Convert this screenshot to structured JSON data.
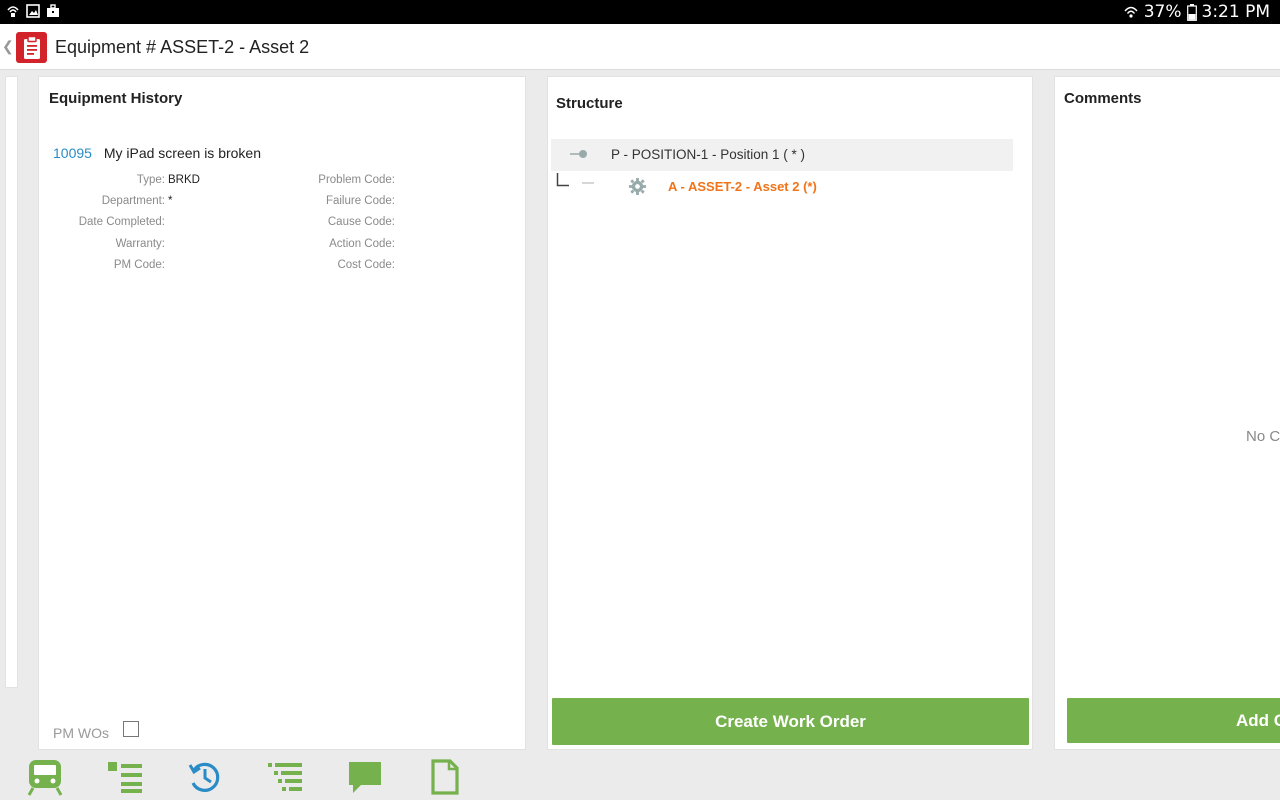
{
  "status_bar": {
    "battery": "37%",
    "time": "3:21 PM",
    "notification_icons": [
      "wifi-tethering-icon",
      "image-icon",
      "briefcase-icon"
    ]
  },
  "header": {
    "title": "Equipment # ASSET-2 - Asset 2",
    "logo_icon": "clipboard-icon",
    "back_icon": "chevron-left-icon"
  },
  "history": {
    "title": "Equipment History",
    "work_order": {
      "number": "10095",
      "description": "My iPad screen is broken"
    },
    "fields_left": [
      {
        "label": "Type:",
        "value": "BRKD"
      },
      {
        "label": "Department:",
        "value": "*"
      },
      {
        "label": "Date Completed:",
        "value": ""
      },
      {
        "label": "Warranty:",
        "value": ""
      },
      {
        "label": "PM Code:",
        "value": ""
      }
    ],
    "fields_right": [
      {
        "label": "Problem Code:",
        "value": ""
      },
      {
        "label": "Failure Code:",
        "value": ""
      },
      {
        "label": "Cause Code:",
        "value": ""
      },
      {
        "label": "Action Code:",
        "value": ""
      },
      {
        "label": "Cost Code:",
        "value": ""
      }
    ],
    "pm_wos_label": "PM WOs",
    "pm_wos_checked": false
  },
  "structure": {
    "title": "Structure",
    "nodes": [
      {
        "label": "P - POSITION-1 - Position 1 ( * )",
        "icon": "position-pin-icon"
      },
      {
        "label": "A - ASSET-2 - Asset 2 (*)",
        "icon": "gear-icon"
      }
    ],
    "create_button": "Create Work Order"
  },
  "comments": {
    "title": "Comments",
    "empty_text": "No C",
    "add_button": "Add C"
  },
  "toolbar": {
    "icons": [
      "train-icon",
      "list-icon",
      "history-icon",
      "indented-list-icon",
      "comment-icon",
      "document-icon"
    ],
    "active_index": 2,
    "accent_color": "#75b14c",
    "active_color": "#2a8cc7"
  },
  "colors": {
    "accent_green": "#75b14c",
    "link_blue": "#2a8cc7",
    "asset_orange": "#f07419",
    "logo_red": "#d2232a"
  }
}
